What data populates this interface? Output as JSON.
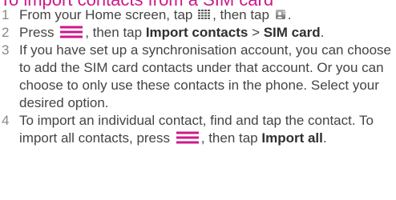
{
  "heading": "To import contacts from a SIM card",
  "steps": [
    {
      "number": "1",
      "text_a": "From your Home screen, tap ",
      "text_b": ", then tap ",
      "text_c": "."
    },
    {
      "number": "2",
      "text_a": "Press ",
      "text_b": ", then tap ",
      "bold_a": "Import contacts",
      "text_c": " > ",
      "bold_b": "SIM card",
      "text_d": "."
    },
    {
      "number": "3",
      "text": "If you have set up a synchronisation account, you can choose to add the SIM card contacts under that account. Or you can choose to only use these contacts in the phone. Select your desired option."
    },
    {
      "number": "4",
      "text_a": "To import an individual contact, find and tap the contact. To import all contacts, press ",
      "text_b": ", then tap ",
      "bold_a": "Import all",
      "text_c": "."
    }
  ],
  "icons": {
    "apps": "apps-grid-icon",
    "contacts": "contacts-app-icon",
    "menu": "menu-key-icon"
  },
  "colors": {
    "heading": "#cc1a8a",
    "menu_icon": "#cc1a8a",
    "text": "#444444",
    "number": "#888888"
  }
}
